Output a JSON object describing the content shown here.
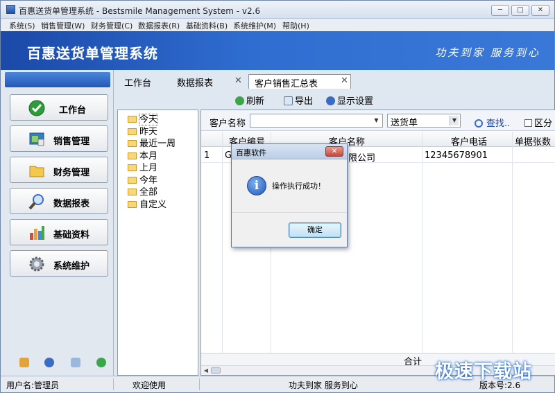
{
  "window": {
    "title": "百惠送货单管理系统 - Bestsmile Management System - v2.6",
    "controls": [
      "─",
      "□",
      "✕"
    ]
  },
  "menu": [
    "系统(S)",
    "销售管理(W)",
    "财务管理(C)",
    "数据报表(R)",
    "基础资料(B)",
    "系统维护(M)",
    "帮助(H)"
  ],
  "banner": {
    "title": "百惠送货单管理系统",
    "slogan": "功夫到家 服务到心"
  },
  "nav": [
    {
      "label": "工作台",
      "icon": "checkmark-icon",
      "color": "#2e9c3a"
    },
    {
      "label": "销售管理",
      "icon": "sales-window-icon",
      "color": "#2f7fc9"
    },
    {
      "label": "财务管理",
      "icon": "folder-icon",
      "color": "#e8b73a"
    },
    {
      "label": "数据报表",
      "icon": "magnifier-icon",
      "color": "#3a6cc4"
    },
    {
      "label": "基础资料",
      "icon": "chart-bars-icon",
      "color": "#d84b3c"
    },
    {
      "label": "系统维护",
      "icon": "gear-icon",
      "color": "#7d8590"
    }
  ],
  "tabs": [
    {
      "label": "工作台"
    },
    {
      "label": "数据报表"
    },
    {
      "label": "客户销售汇总表",
      "active": true
    }
  ],
  "toolbar": {
    "refresh": "刷新",
    "export": "导出",
    "settings": "显示设置"
  },
  "tree": [
    "今天",
    "昨天",
    "最近一周",
    "本月",
    "上月",
    "今年",
    "全部",
    "自定义"
  ],
  "filter": {
    "customer_label": "客户名称",
    "customer_value": "",
    "type_value": "送货单",
    "search": "查找..",
    "checkbox_label": "区分"
  },
  "grid": {
    "headers": [
      "客户编号",
      "客户名称",
      "客户电话",
      "单据张数"
    ],
    "rows": [
      {
        "index": "1",
        "code": "Gl",
        "name": "限公司",
        "phone": "12345678901"
      }
    ],
    "sum_label": "合计"
  },
  "dialog": {
    "title": "百惠软件",
    "message": "操作执行成功！",
    "ok": "确定",
    "close": "✕"
  },
  "status": {
    "user": "用户名:管理员",
    "welcome": "欢迎使用",
    "slogan": "功夫到家 服务到心",
    "version": "版本号:2.6"
  },
  "watermark": "极速下载站",
  "colors": {
    "banner": "#2458b5",
    "accent": "#3a78d8"
  }
}
